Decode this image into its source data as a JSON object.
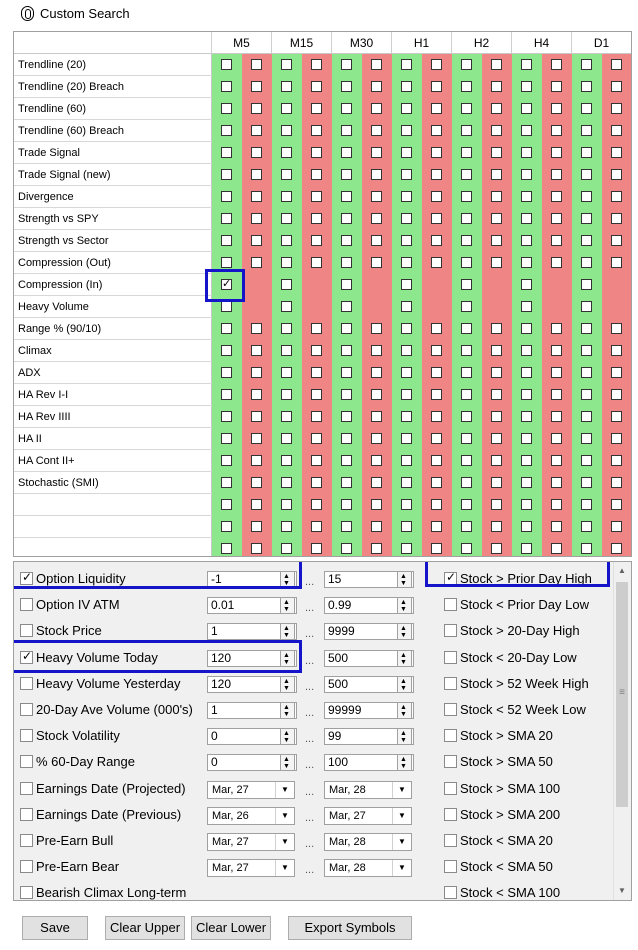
{
  "window": {
    "title": "Custom Search"
  },
  "timeframes": [
    "M5",
    "M15",
    "M30",
    "H1",
    "H2",
    "H4",
    "D1"
  ],
  "signals": [
    "Trendline (20)",
    "Trendline (20) Breach",
    "Trendline (60)",
    "Trendline (60) Breach",
    "Trade Signal",
    "Trade Signal (new)",
    "Divergence",
    "Strength vs SPY",
    "Strength vs Sector",
    "Compression (Out)",
    "Compression (In)",
    "Heavy Volume",
    "Range % (90/10)",
    "Climax",
    "ADX",
    "HA Rev I-I",
    "HA Rev IIII",
    "HA II",
    "HA Cont II+",
    "Stochastic (SMI)",
    "",
    "",
    ""
  ],
  "checked_signal": {
    "row": "Compression (In)",
    "timeframe": "M5",
    "column": "green"
  },
  "filters": [
    {
      "label": "Option Liquidity",
      "checked": true,
      "min": "-1",
      "max": "15",
      "type": "num"
    },
    {
      "label": "Option IV ATM",
      "checked": false,
      "min": "0.01",
      "max": "0.99",
      "type": "num"
    },
    {
      "label": "Stock Price",
      "checked": false,
      "min": "1",
      "max": "9999",
      "type": "num"
    },
    {
      "label": "Heavy Volume Today",
      "checked": true,
      "min": "120",
      "max": "500",
      "type": "num"
    },
    {
      "label": "Heavy Volume Yesterday",
      "checked": false,
      "min": "120",
      "max": "500",
      "type": "num"
    },
    {
      "label": "20-Day Ave Volume (000's)",
      "checked": false,
      "min": "1",
      "max": "99999",
      "type": "num"
    },
    {
      "label": "Stock Volatility",
      "checked": false,
      "min": "0",
      "max": "99",
      "type": "num"
    },
    {
      "label": "% 60-Day Range",
      "checked": false,
      "min": "0",
      "max": "100",
      "type": "num"
    },
    {
      "label": "Earnings Date (Projected)",
      "checked": false,
      "min": "Mar, 27",
      "max": "Mar, 28",
      "type": "date"
    },
    {
      "label": "Earnings Date (Previous)",
      "checked": false,
      "min": "Mar, 26",
      "max": "Mar, 27",
      "type": "date"
    },
    {
      "label": "Pre-Earn Bull",
      "checked": false,
      "min": "Mar, 27",
      "max": "Mar, 28",
      "type": "date"
    },
    {
      "label": "Pre-Earn Bear",
      "checked": false,
      "min": "Mar, 27",
      "max": "Mar, 28",
      "type": "date"
    },
    {
      "label": "Bearish Climax Long-term",
      "checked": false,
      "type": "none"
    }
  ],
  "range_separator": "...",
  "price_conditions": [
    {
      "label": "Stock > Prior Day High",
      "checked": true
    },
    {
      "label": "Stock < Prior Day Low",
      "checked": false
    },
    {
      "label": "Stock > 20-Day High",
      "checked": false
    },
    {
      "label": "Stock < 20-Day Low",
      "checked": false
    },
    {
      "label": "Stock > 52 Week High",
      "checked": false
    },
    {
      "label": "Stock < 52 Week Low",
      "checked": false
    },
    {
      "label": "Stock > SMA 20",
      "checked": false
    },
    {
      "label": "Stock > SMA 50",
      "checked": false
    },
    {
      "label": "Stock > SMA 100",
      "checked": false
    },
    {
      "label": "Stock > SMA 200",
      "checked": false
    },
    {
      "label": "Stock < SMA 20",
      "checked": false
    },
    {
      "label": "Stock < SMA 50",
      "checked": false
    },
    {
      "label": "Stock < SMA 100",
      "checked": false
    }
  ],
  "buttons": {
    "save": "Save",
    "clear_upper": "Clear Upper",
    "clear_lower": "Clear Lower",
    "export": "Export Symbols"
  },
  "colors": {
    "bullish": "#8de88d",
    "bearish": "#f08585",
    "highlight": "#1414c8"
  }
}
